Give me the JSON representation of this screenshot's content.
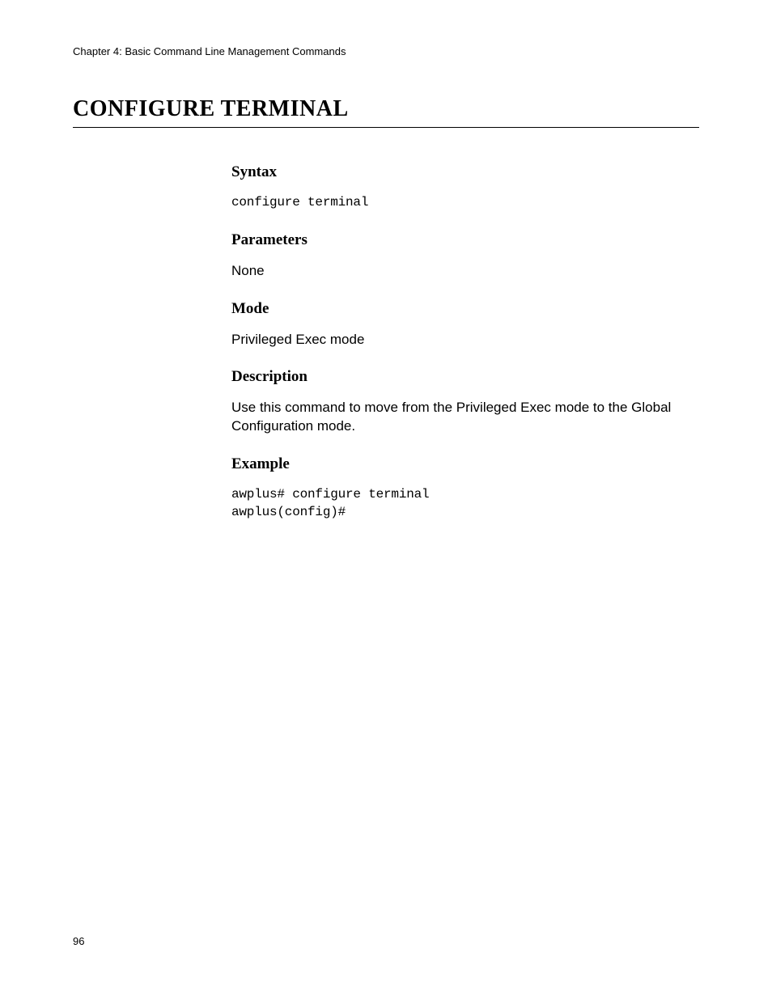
{
  "header": {
    "chapter": "Chapter 4: Basic Command Line Management Commands"
  },
  "title": "CONFIGURE TERMINAL",
  "sections": {
    "syntax": {
      "heading": "Syntax",
      "code": "configure terminal"
    },
    "parameters": {
      "heading": "Parameters",
      "text": "None"
    },
    "mode": {
      "heading": "Mode",
      "text": "Privileged Exec mode"
    },
    "description": {
      "heading": "Description",
      "text": "Use this command to move from the Privileged Exec mode to the Global Configuration mode."
    },
    "example": {
      "heading": "Example",
      "code": "awplus# configure terminal\nawplus(config)#"
    }
  },
  "footer": {
    "page_number": "96"
  }
}
